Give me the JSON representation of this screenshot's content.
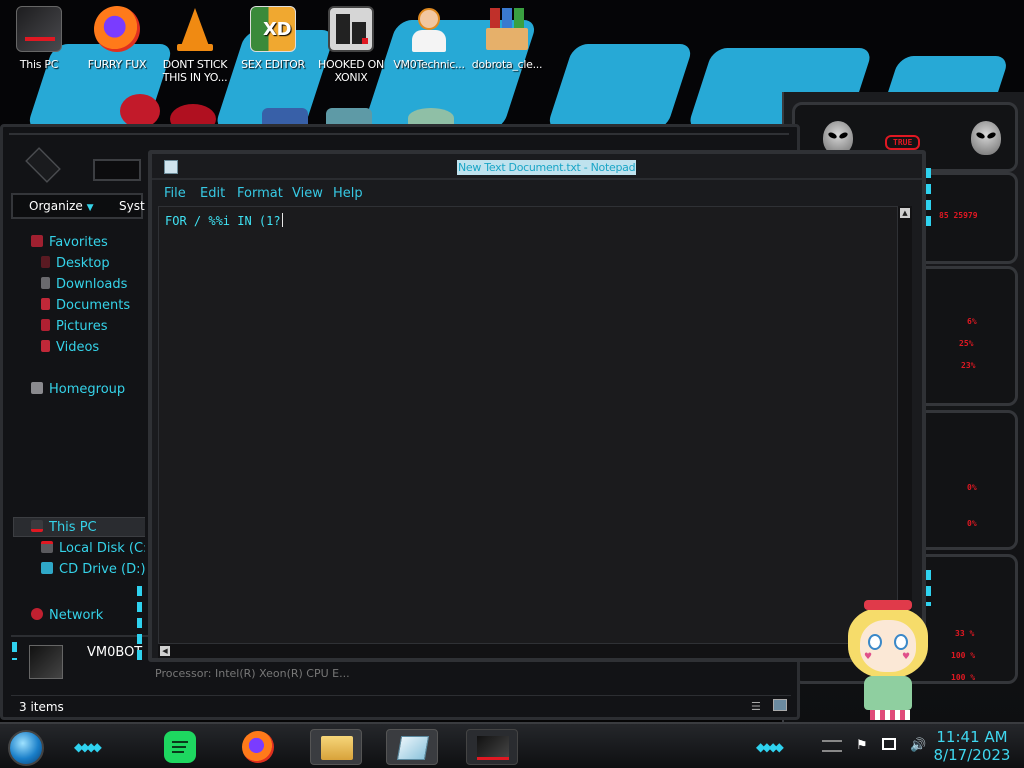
{
  "desktop": {
    "icons": [
      {
        "label": "This PC",
        "icon": "this-pc-icon"
      },
      {
        "label": "FURRY FUX",
        "icon": "firefox-icon"
      },
      {
        "label": "DONT STICK THIS IN YO...",
        "icon": "vlc-icon"
      },
      {
        "label": "SEX EDITOR",
        "icon": "xd-editor-icon"
      },
      {
        "label": "HOOKED ON XONIX",
        "icon": "xonix-game-icon"
      },
      {
        "label": "VM0Technic...",
        "icon": "technician-icon"
      },
      {
        "label": "dobrota_cle...",
        "icon": "archive-icon"
      }
    ]
  },
  "explorer": {
    "organize_label": "Organize",
    "system_label": "Syst",
    "nav": [
      {
        "label": "Favorites",
        "icon": "favorites-icon"
      },
      {
        "label": "Desktop",
        "icon": "desktop-icon"
      },
      {
        "label": "Downloads",
        "icon": "downloads-icon"
      },
      {
        "label": "Documents",
        "icon": "documents-icon"
      },
      {
        "label": "Pictures",
        "icon": "pictures-icon"
      },
      {
        "label": "Videos",
        "icon": "videos-icon"
      },
      {
        "label": "Homegroup",
        "icon": "homegroup-icon"
      },
      {
        "label": "This PC",
        "icon": "this-pc-icon"
      },
      {
        "label": "Local Disk (C:",
        "icon": "local-disk-icon"
      },
      {
        "label": "CD Drive (D:) I",
        "icon": "cd-drive-icon"
      },
      {
        "label": "Network",
        "icon": "network-icon"
      }
    ],
    "details_name": "VM0BOT",
    "details_processor": "Processor: Intel(R) Xeon(R) CPU E...",
    "status_items": "3 items"
  },
  "notepad": {
    "title": "New Text Document.txt - Notepad",
    "menu": [
      "File",
      "Edit",
      "Format",
      "View",
      "Help"
    ],
    "content": "FOR / %%i IN (1?"
  },
  "gadgets": {
    "labels": [
      "TRUE",
      "85 25979",
      "6%",
      "25%",
      "23%",
      "0%",
      "0%",
      "33 %",
      "100 %",
      "100 %"
    ]
  },
  "taskbar": {
    "apps": [
      "spotify-icon",
      "firefox-icon",
      "file-explorer-icon",
      "notepad-icon",
      "computer-icon"
    ],
    "tray_icons": [
      "flag-icon",
      "network-tray-icon",
      "volume-icon"
    ],
    "time": "11:41 AM",
    "date": "8/17/2023"
  },
  "colors": {
    "accent_cyan": "#2fd2ef",
    "alert_red": "#e01822",
    "window_bg": "#1a1b1e"
  }
}
